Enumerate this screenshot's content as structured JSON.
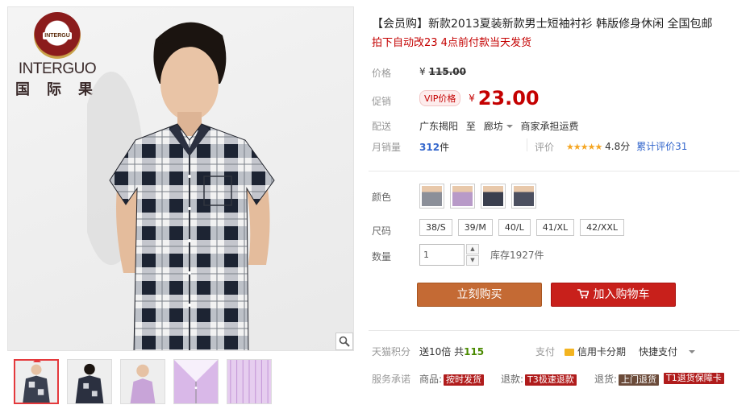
{
  "gallery": {
    "brand_name": "INTERGUO",
    "brand_cn": "国 际 果",
    "badge_text": "INTERGU"
  },
  "product": {
    "title": "【会员购】新款2013夏装新款男士短袖衬衫 韩版修身休闲 全国包邮",
    "subtitle": "拍下自动改23 4点前付款当天发货"
  },
  "price": {
    "orig_label": "价格",
    "orig_yen": "¥",
    "orig_value": "115.00",
    "promo_label": "促销",
    "vip_badge": "VIP价格",
    "promo_yen": "¥",
    "promo_value": "23.00"
  },
  "delivery": {
    "label": "配送",
    "from": "广东揭阳",
    "to_word": "至",
    "to": "廊坊",
    "shipping": "商家承担运费"
  },
  "sales": {
    "label": "月销量",
    "count": "312",
    "unit": "件",
    "rating_label": "评价",
    "stars": "★★★★★",
    "score": "4.8分",
    "total_reviews": "累计评价31"
  },
  "options": {
    "color_label": "颜色",
    "size_label": "尺码",
    "sizes": [
      "38/S",
      "39/M",
      "40/L",
      "41/XL",
      "42/XXL"
    ],
    "qty_label": "数量",
    "qty_value": "1",
    "stock": "库存1927件"
  },
  "actions": {
    "buy_now": "立刻购买",
    "add_to_cart": "加入购物车"
  },
  "points": {
    "label": "天猫积分",
    "text_prefix": "送10倍 共",
    "value": "115"
  },
  "payment": {
    "label": "支付",
    "card": "信用卡分期",
    "quick": "快捷支付"
  },
  "service": {
    "label": "服务承诺",
    "goods_label": "商品:",
    "goods_tag": "按时发货",
    "refund_label": "退款:",
    "refund_tag": "T3极速退款",
    "return_label": "退货:",
    "return_tag": "上门退货",
    "guarantee_tag": "T1退货保障卡"
  },
  "colors": {
    "accent_red": "#c40000",
    "buy_button": "#c46a34",
    "cart_button": "#c8201b"
  }
}
